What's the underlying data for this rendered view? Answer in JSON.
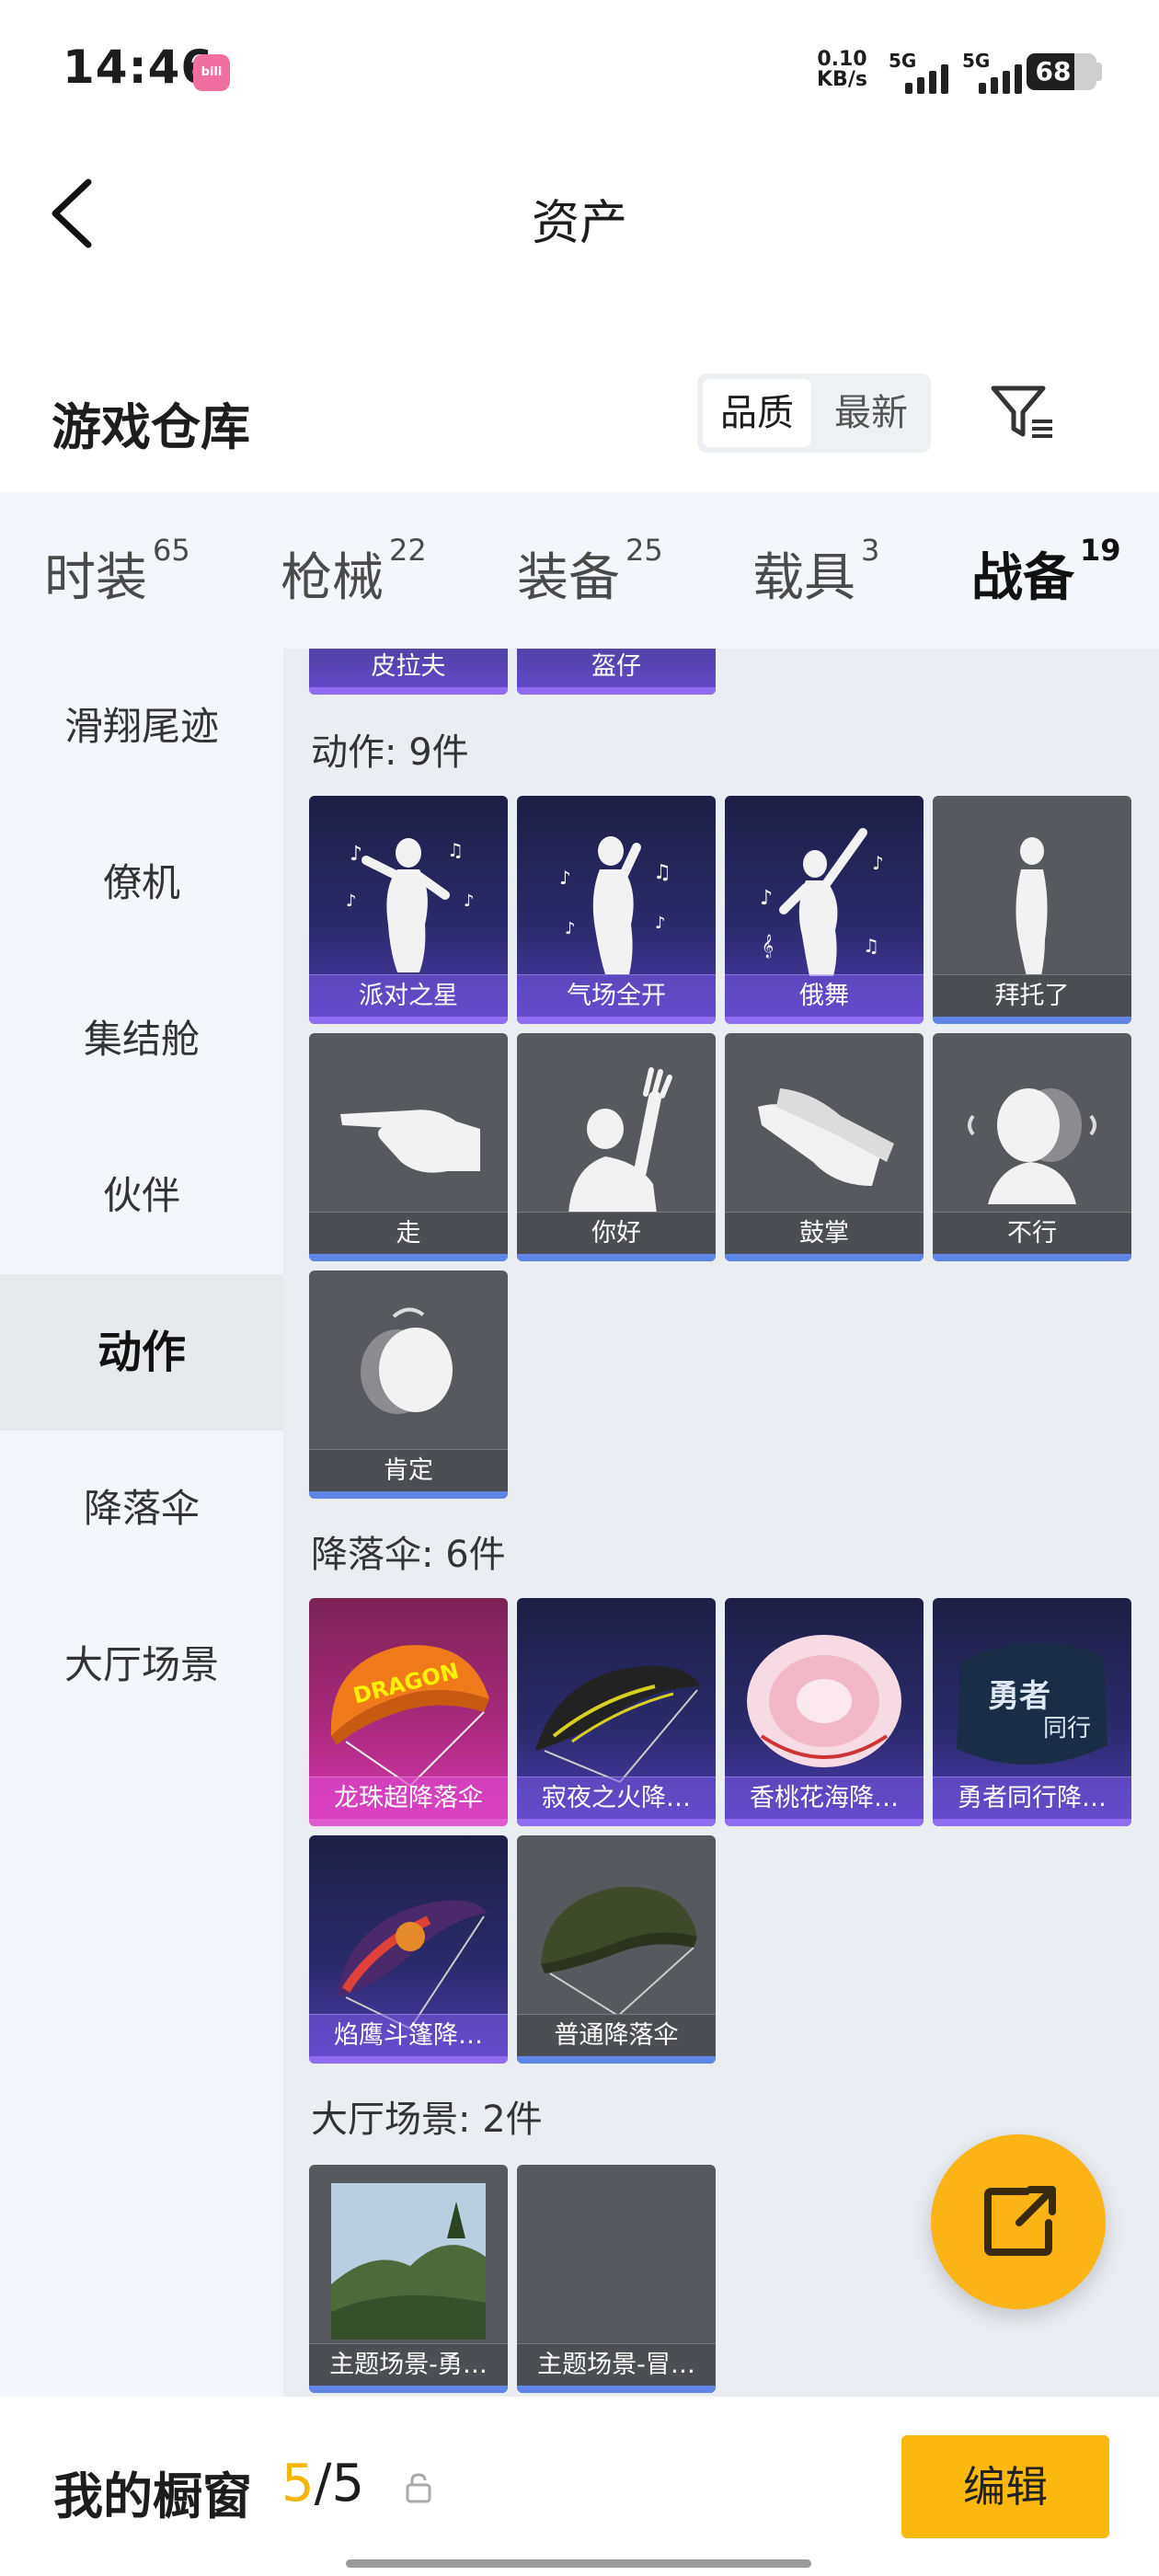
{
  "status_bar": {
    "time": "14:46",
    "net_speed_value": "0.10",
    "net_speed_unit": "KB/s",
    "signal1_label": "5G",
    "signal2_label": "5G",
    "battery": "68",
    "battery_level": 0.68
  },
  "nav": {
    "title": "资产"
  },
  "header": {
    "title": "游戏仓库",
    "sort_options": [
      "品质",
      "最新"
    ],
    "sort_selected": "品质"
  },
  "tabs": [
    {
      "label": "时装",
      "count": "65"
    },
    {
      "label": "枪械",
      "count": "22"
    },
    {
      "label": "装备",
      "count": "25"
    },
    {
      "label": "载具",
      "count": "3"
    },
    {
      "label": "战备",
      "count": "19"
    }
  ],
  "sidebar": [
    "滑翔尾迹",
    "僚机",
    "集结舱",
    "伙伴",
    "动作",
    "降落伞",
    "大厅场景"
  ],
  "sidebar_selected": "动作",
  "top_partial_items": [
    "皮拉夫",
    "盔仔"
  ],
  "sections": [
    {
      "title": "动作: 9件",
      "items": [
        {
          "label": "派对之星",
          "icon": "dance-pose-icon",
          "rarity": "purple"
        },
        {
          "label": "气场全开",
          "icon": "sing-pose-icon",
          "rarity": "purple"
        },
        {
          "label": "俄舞",
          "icon": "ballet-pose-icon",
          "rarity": "purple"
        },
        {
          "label": "拜托了",
          "icon": "pray-pose-icon",
          "rarity": "grey"
        },
        {
          "label": "走",
          "icon": "pointing-hand-icon",
          "rarity": "grey"
        },
        {
          "label": "你好",
          "icon": "waving-person-icon",
          "rarity": "grey"
        },
        {
          "label": "鼓掌",
          "icon": "clapping-hands-icon",
          "rarity": "grey"
        },
        {
          "label": "不行",
          "icon": "head-shake-icon",
          "rarity": "grey"
        },
        {
          "label": "肯定",
          "icon": "head-nod-icon",
          "rarity": "grey"
        }
      ]
    },
    {
      "title": "降落伞: 6件",
      "items": [
        {
          "label": "龙珠超降落伞",
          "icon": "parachute-orange-icon",
          "rarity": "pink"
        },
        {
          "label": "寂夜之火降…",
          "icon": "parachute-dark-icon",
          "rarity": "purple"
        },
        {
          "label": "香桃花海降…",
          "icon": "parachute-pink-icon",
          "rarity": "purple"
        },
        {
          "label": "勇者同行降…",
          "icon": "parachute-navy-icon",
          "rarity": "purple"
        },
        {
          "label": "焰鹰斗篷降…",
          "icon": "parachute-red-icon",
          "rarity": "purple"
        },
        {
          "label": "普通降落伞",
          "icon": "parachute-green-icon",
          "rarity": "grey"
        }
      ]
    },
    {
      "title": "大厅场景: 2件",
      "items": [
        {
          "label": "主题场景-勇…",
          "icon": "landscape-icon",
          "rarity": "grey"
        },
        {
          "label": "主题场景-冒…",
          "icon": "empty-scene-icon",
          "rarity": "grey"
        }
      ]
    }
  ],
  "bottom_bar": {
    "title": "我的橱窗",
    "count_current": "5",
    "count_total": "/5",
    "edit_label": "编辑"
  }
}
